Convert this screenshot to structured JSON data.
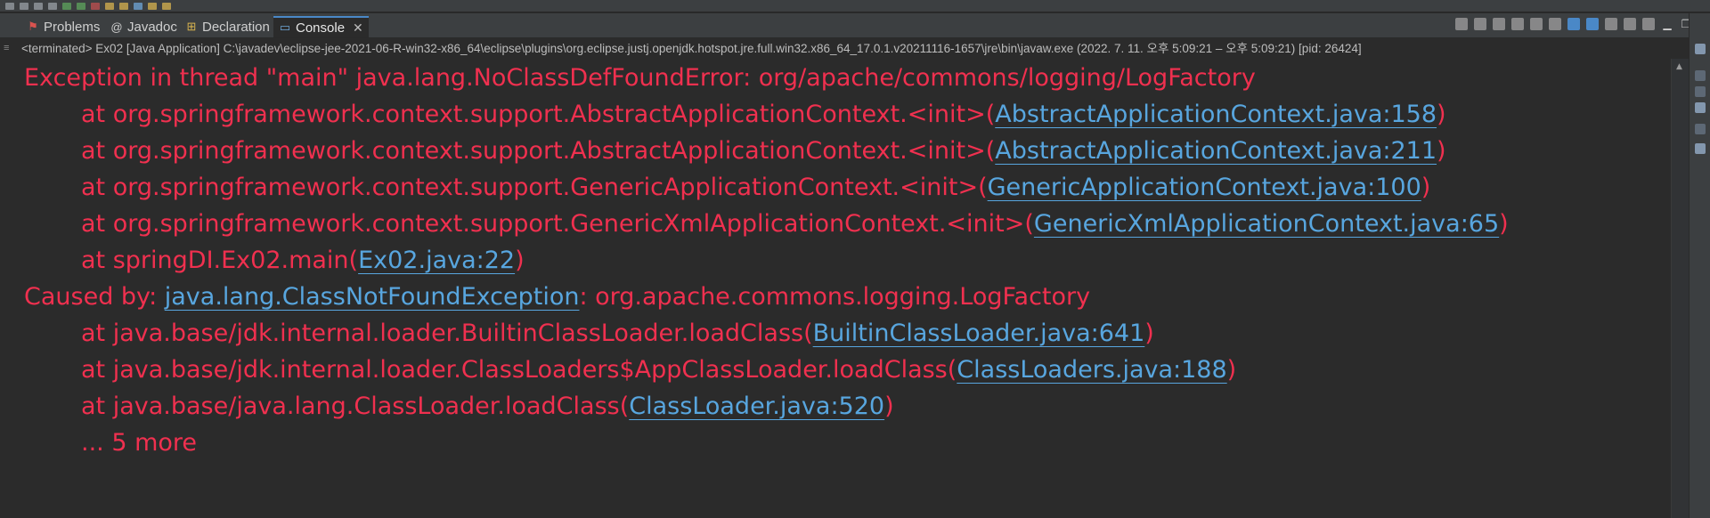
{
  "tabs": [
    {
      "label": "Problems",
      "icon": "problems-icon",
      "glyph": "⚑"
    },
    {
      "label": "Javadoc",
      "icon": "javadoc-icon",
      "glyph": "@"
    },
    {
      "label": "Declaration",
      "icon": "declaration-icon",
      "glyph": "⊞"
    },
    {
      "label": "Console",
      "icon": "console-icon",
      "glyph": "▭"
    }
  ],
  "close_glyph": "✕",
  "status_line": "<terminated> Ex02 [Java Application] C:\\javadev\\eclipse-jee-2021-06-R-win32-x86_64\\eclipse\\plugins\\org.eclipse.justj.openjdk.hotspot.jre.full.win32.x86_64_17.0.1.v20211116-1657\\jre\\bin\\javaw.exe  (2022. 7. 11. 오후 5:09:21 – 오후 5:09:21) [pid: 26424]",
  "console": {
    "lines": [
      {
        "indent": false,
        "pre": "Exception in thread \"main\" java.lang.NoClassDefFoundError: org/apache/commons/logging/LogFactory",
        "link": "",
        "post": ""
      },
      {
        "indent": true,
        "pre": "at org.springframework.context.support.AbstractApplicationContext.<init>(",
        "link": "AbstractApplicationContext.java:158",
        "post": ")"
      },
      {
        "indent": true,
        "pre": "at org.springframework.context.support.AbstractApplicationContext.<init>(",
        "link": "AbstractApplicationContext.java:211",
        "post": ")"
      },
      {
        "indent": true,
        "pre": "at org.springframework.context.support.GenericApplicationContext.<init>(",
        "link": "GenericApplicationContext.java:100",
        "post": ")"
      },
      {
        "indent": true,
        "pre": "at org.springframework.context.support.GenericXmlApplicationContext.<init>(",
        "link": "GenericXmlApplicationContext.java:65",
        "post": ")"
      },
      {
        "indent": true,
        "pre": "at springDI.Ex02.main(",
        "link": "Ex02.java:22",
        "post": ")"
      },
      {
        "indent": false,
        "pre": "Caused by: ",
        "link": "java.lang.ClassNotFoundException",
        "post": ": org.apache.commons.logging.LogFactory"
      },
      {
        "indent": true,
        "pre": "at java.base/jdk.internal.loader.BuiltinClassLoader.loadClass(",
        "link": "BuiltinClassLoader.java:641",
        "post": ")"
      },
      {
        "indent": true,
        "pre": "at java.base/jdk.internal.loader.ClassLoaders$AppClassLoader.loadClass(",
        "link": "ClassLoaders.java:188",
        "post": ")"
      },
      {
        "indent": true,
        "pre": "at java.base/java.lang.ClassLoader.loadClass(",
        "link": "ClassLoader.java:520",
        "post": ")"
      },
      {
        "indent": true,
        "pre": "... 5 more",
        "link": "",
        "post": ""
      }
    ]
  },
  "colors": {
    "error": "#f0304f",
    "link": "#58a6df",
    "background": "#2b2b2b"
  }
}
